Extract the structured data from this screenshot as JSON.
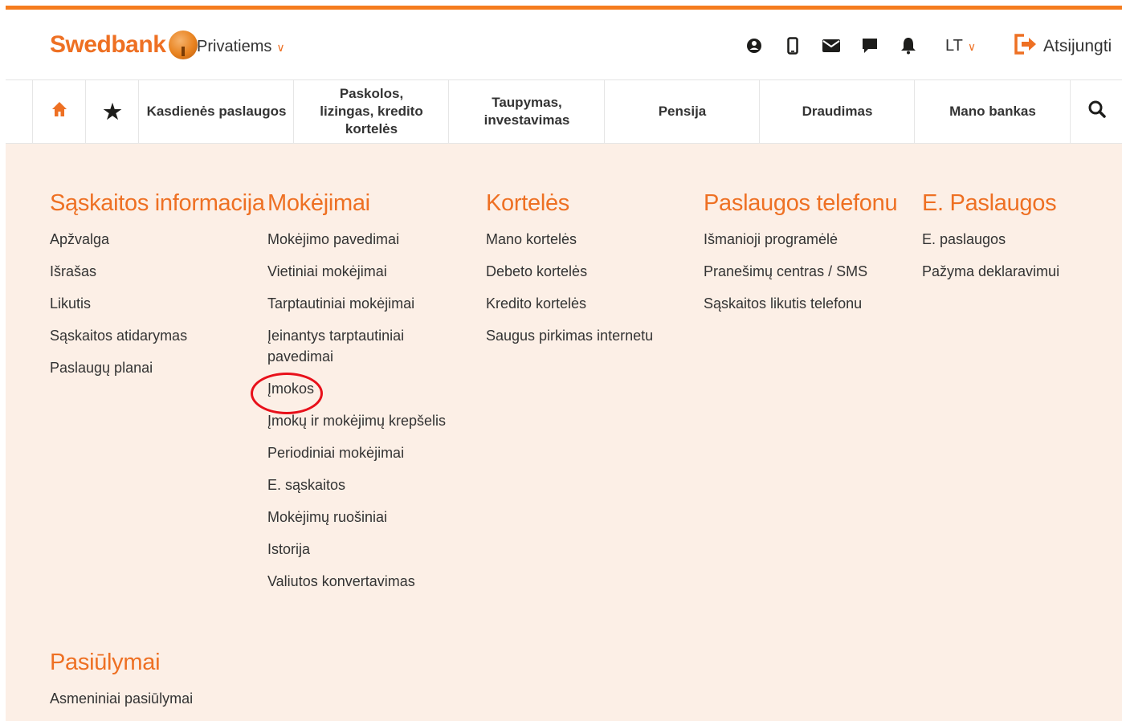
{
  "header": {
    "brand": "Swedbank",
    "segment": "Privatiems",
    "language": "LT",
    "logout_label": "Atsijungti",
    "icons": [
      "user-icon",
      "mobile-icon",
      "mail-icon",
      "chat-icon",
      "bell-icon"
    ],
    "accent_color": "#ee7023"
  },
  "nav": {
    "items": [
      {
        "label": ""
      },
      {
        "label": ""
      },
      {
        "label": "Kasdienės paslaugos"
      },
      {
        "label": "Paskolos, lizingas, kredito kortelės"
      },
      {
        "label": "Taupymas, investavimas"
      },
      {
        "label": "Pensija"
      },
      {
        "label": "Draudimas"
      },
      {
        "label": "Mano bankas"
      }
    ]
  },
  "menu": {
    "columns": [
      {
        "title": "Sąskaitos informacija",
        "items": [
          "Apžvalga",
          "Išrašas",
          "Likutis",
          "Sąskaitos atidarymas",
          "Paslaugų planai"
        ]
      },
      {
        "title": "Mokėjimai",
        "items": [
          "Mokėjimo pavedimai",
          "Vietiniai mokėjimai",
          "Tarptautiniai mokėjimai",
          "Įeinantys tarptautiniai pavedimai",
          "Įmokos",
          "Įmokų ir mokėjimų krepšelis",
          "Periodiniai mokėjimai",
          "E. sąskaitos",
          "Mokėjimų ruošiniai",
          "Istorija",
          "Valiutos konvertavimas"
        ]
      },
      {
        "title": "Kortelės",
        "items": [
          "Mano kortelės",
          "Debeto kortelės",
          "Kredito kortelės",
          "Saugus pirkimas internetu"
        ]
      },
      {
        "title": "Paslaugos telefonu",
        "items": [
          "Išmanioji programėlė",
          "Pranešimų centras / SMS",
          "Sąskaitos likutis telefonu"
        ]
      },
      {
        "title": "E. Paslaugos",
        "items": [
          "E. paslaugos",
          "Pažyma deklaravimui"
        ]
      }
    ],
    "offers": {
      "title": "Pasiūlymai",
      "items": [
        "Asmeniniai pasiūlymai"
      ]
    }
  }
}
